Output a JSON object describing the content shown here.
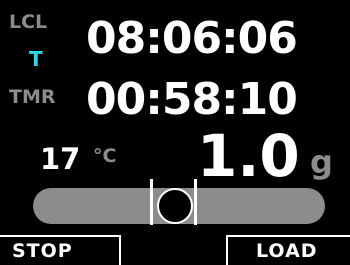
{
  "labels": {
    "lcl": "LCL",
    "t": "T",
    "tmr": "TMR"
  },
  "times": {
    "local": "08:06:06",
    "timer": "00:58:10"
  },
  "temperature": {
    "value": "17",
    "unit": "°C"
  },
  "g_load": {
    "value": "1.0",
    "unit": "g"
  },
  "slip_indicator": {
    "ball_position": 0
  },
  "softkeys": {
    "left": "STOP",
    "right": "LOAD"
  },
  "colors": {
    "background": "#000000",
    "text_primary": "#ffffff",
    "text_label": "#8c8c8c",
    "accent_t": "#2fd6ea",
    "bar": "#8c8c8c"
  }
}
